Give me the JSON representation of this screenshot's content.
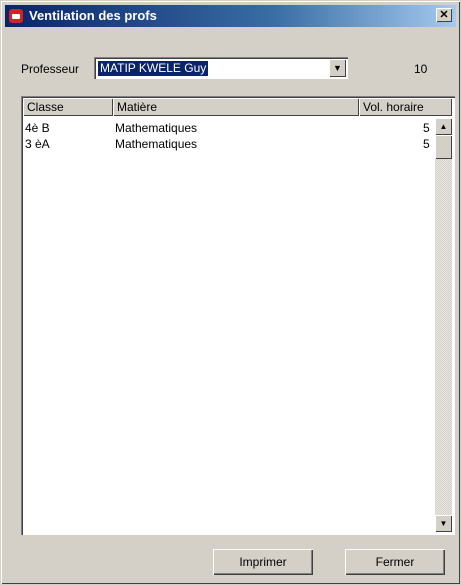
{
  "window": {
    "title": "Ventilation des profs",
    "close_glyph": "✕"
  },
  "form": {
    "professeur_label": "Professeur",
    "professeur_value": "MATIP KWELE Guy",
    "count": "10"
  },
  "table": {
    "columns": [
      "Classe",
      "Matière",
      "Vol. horaire"
    ],
    "rows": [
      {
        "classe": "4è B",
        "matiere": "Mathematiques",
        "volume": "5"
      },
      {
        "classe": "3 èA",
        "matiere": "Mathematiques",
        "volume": "5"
      }
    ]
  },
  "buttons": {
    "print": "Imprimer",
    "close": "Fermer"
  },
  "icons": {
    "title": "window-app-icon",
    "dropdown": "chevron-down-icon",
    "scroll_up": "scroll-up-icon",
    "scroll_down": "scroll-down-icon"
  },
  "colors": {
    "title_start": "#0a246a",
    "title_end": "#a6caf0",
    "selection": "#0a246a",
    "face": "#d4d0c8"
  }
}
